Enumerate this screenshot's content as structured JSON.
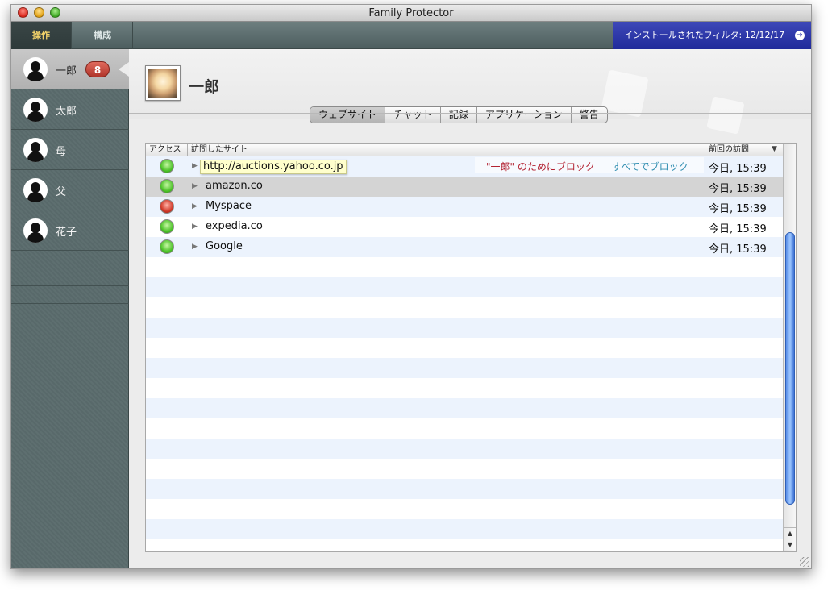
{
  "window": {
    "title": "Family Protector"
  },
  "tabs": [
    {
      "label": "操作",
      "active": true
    },
    {
      "label": "構成",
      "active": false
    }
  ],
  "filter_banner": {
    "label": "インストールされたフィルタ: 12/12/17",
    "icon": "arrow-right-circle-icon"
  },
  "users": [
    {
      "name": "一郎",
      "badge": "8",
      "selected": true
    },
    {
      "name": "太郎"
    },
    {
      "name": "母"
    },
    {
      "name": "父"
    },
    {
      "name": "花子"
    }
  ],
  "profile": {
    "name": "一郎"
  },
  "segments": [
    {
      "label": "ウェブサイト",
      "active": true
    },
    {
      "label": "チャット"
    },
    {
      "label": "記録"
    },
    {
      "label": "アプリケーション"
    },
    {
      "label": "警告"
    }
  ],
  "table": {
    "headers": {
      "access": "アクセス",
      "site": "訪問したサイト",
      "last_visit": "前回の訪問"
    },
    "rows": [
      {
        "status": "green",
        "site": "http://auctions.yahoo.co.jp",
        "last_visit": "今日, 15:39",
        "block_for_user": "\"一郎\" のためにブロック",
        "block_all": "すべてでブロック"
      },
      {
        "status": "green",
        "site": "amazon.co",
        "last_visit": "今日, 15:39",
        "selected": true
      },
      {
        "status": "red",
        "site": "Myspace",
        "last_visit": "今日, 15:39"
      },
      {
        "status": "green",
        "site": "expedia.co",
        "last_visit": "今日, 15:39"
      },
      {
        "status": "green",
        "site": "Google",
        "last_visit": "今日, 15:39"
      }
    ]
  },
  "colors": {
    "sidebar": "#5b6c6d",
    "active_tab_text": "#f3d36a",
    "banner": "#2a34a8",
    "badge": "#c0463a",
    "block_user": "#b22030",
    "block_all": "#2f8db0"
  }
}
